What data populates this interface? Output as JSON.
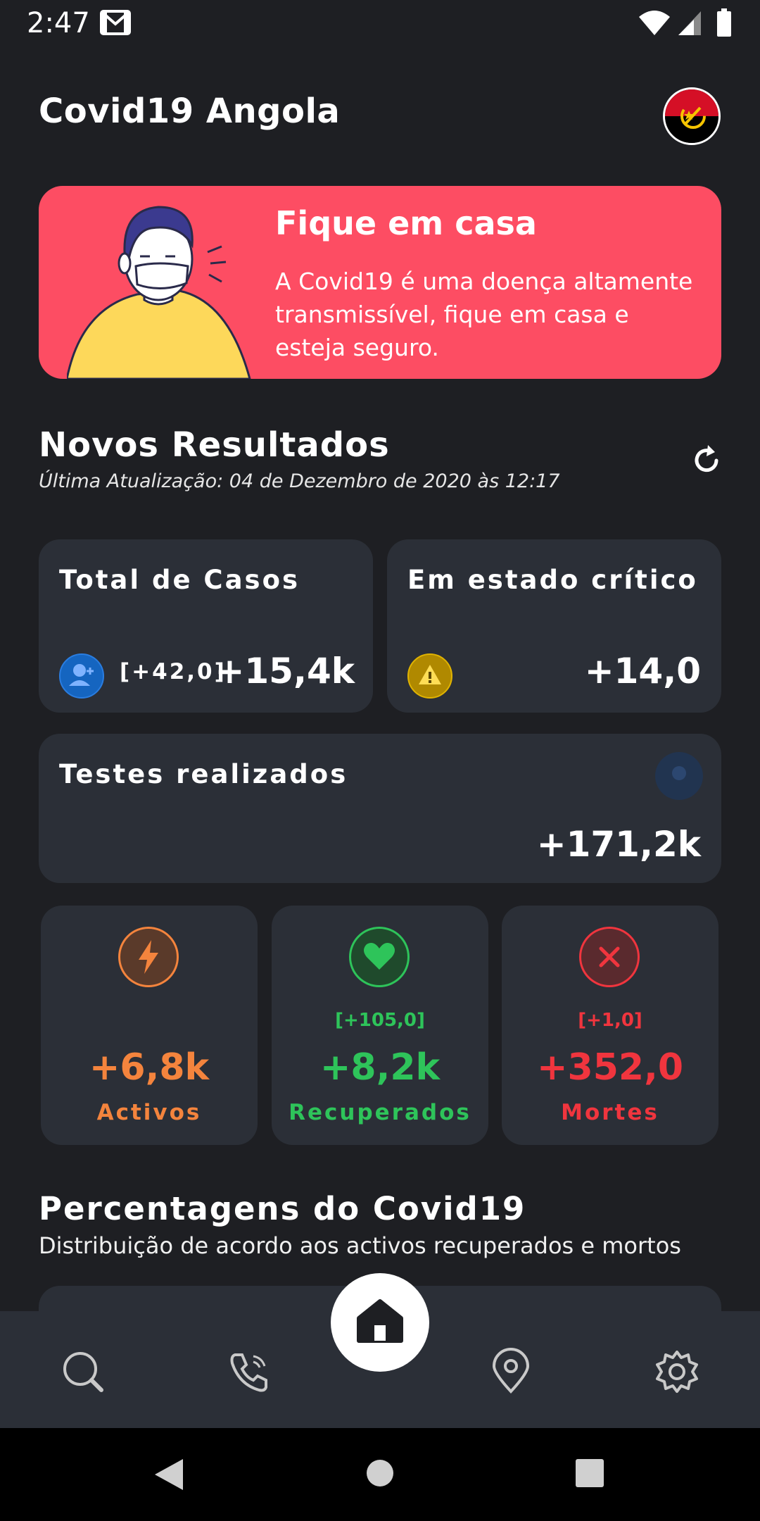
{
  "status_bar": {
    "time": "2:47"
  },
  "header": {
    "title": "Covid19 Angola"
  },
  "banner": {
    "title": "Fique em casa",
    "text": "A Covid19 é uma doença altamente transmissível, fique em casa e esteja seguro."
  },
  "results": {
    "title": "Novos Resultados",
    "last_update": "Última Atualização: 04 de Dezembro de 2020 às 12:17"
  },
  "cards": {
    "total": {
      "title": "Total de Casos",
      "delta": "[+42,0]",
      "value": "+15,4k"
    },
    "critical": {
      "title": "Em estado crítico",
      "value": "+14,0"
    },
    "tests": {
      "title": "Testes realizados",
      "value": "+171,2k"
    }
  },
  "stats": {
    "active": {
      "value": "+6,8k",
      "label": "Activos",
      "color": "#f4843d"
    },
    "recovered": {
      "delta": "[+105,0]",
      "value": "+8,2k",
      "label": "Recuperados",
      "color": "#2ec45a"
    },
    "deaths": {
      "delta": "[+1,0]",
      "value": "+352,0",
      "label": "Mortes",
      "color": "#f0353e"
    }
  },
  "percentages": {
    "title": "Percentagens do Covid19",
    "subtitle": "Distribuição de acordo aos activos recuperados e mortos"
  },
  "nav": {
    "items": [
      "search-icon",
      "phone-icon",
      "home-icon",
      "location-icon",
      "settings-icon"
    ]
  }
}
